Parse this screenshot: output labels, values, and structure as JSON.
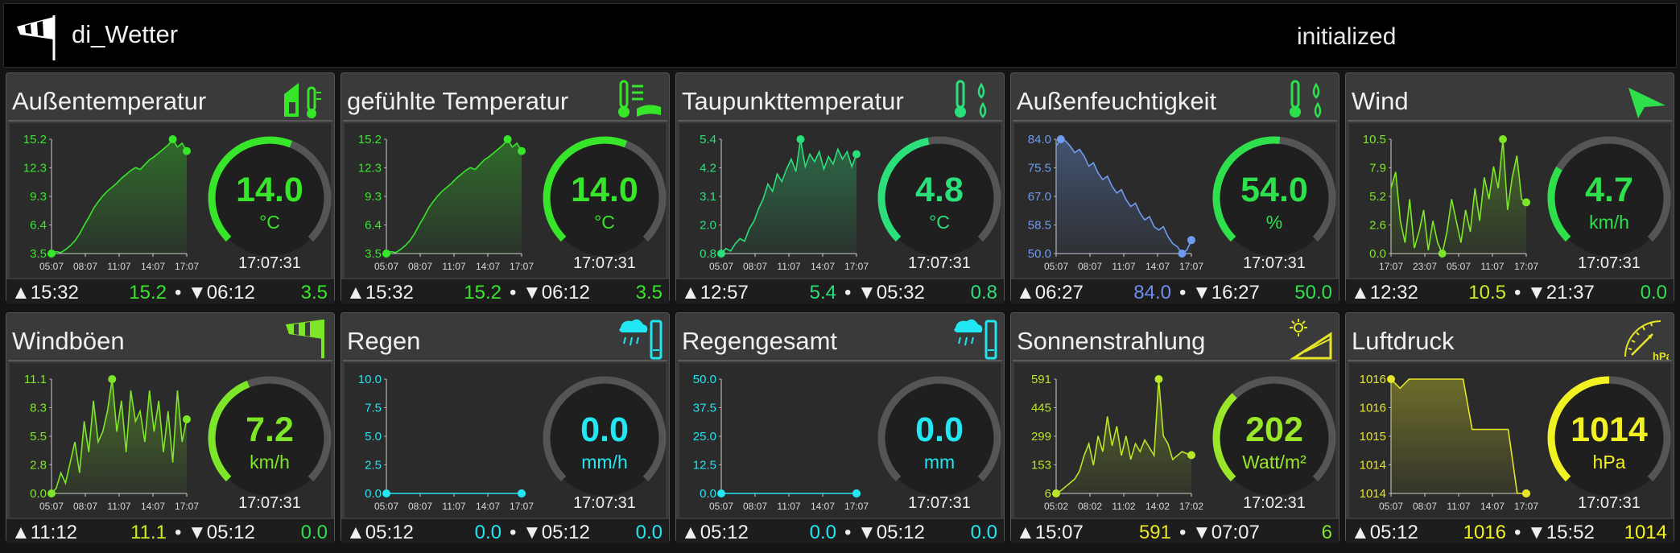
{
  "app": {
    "title": "di_Wetter",
    "status": "initialized"
  },
  "tiles": [
    {
      "title": "Außentemperatur",
      "icon": "thermometer-house-icon",
      "value": "14.0",
      "unit": "°C",
      "time": "17:07:31",
      "color": "#37e629",
      "gauge_fraction": 0.58,
      "chart": {
        "yticks": [
          "15.2",
          "12.3",
          "9.3",
          "6.4",
          "3.5"
        ],
        "xticks": [
          "05:07",
          "08:07",
          "11:07",
          "14:07",
          "17:07"
        ],
        "line_color": "#37e629",
        "ymin": 3.5,
        "ymax": 15.2,
        "values": [
          3.5,
          3.7,
          3.6,
          3.9,
          4.3,
          4.8,
          5.5,
          6.4,
          7.2,
          8.1,
          8.8,
          9.4,
          9.9,
          10.3,
          10.7,
          11.2,
          11.6,
          12.0,
          12.3,
          12.1,
          12.6,
          13.1,
          13.4,
          13.8,
          14.2,
          14.6,
          15.2,
          14.4,
          14.8,
          14.0
        ],
        "max_index": 26,
        "min_index": 0
      },
      "footer": {
        "max_time": "▲15:32",
        "max": "15.2",
        "min_time": "▼06:12",
        "min": "3.5"
      },
      "footer_color": "#37e629"
    },
    {
      "title": "gefühlte Temperatur",
      "icon": "feels-like-thermometer-icon",
      "value": "14.0",
      "unit": "°C",
      "time": "17:07:31",
      "color": "#37e629",
      "gauge_fraction": 0.58,
      "chart": {
        "yticks": [
          "15.2",
          "12.3",
          "9.3",
          "6.4",
          "3.5"
        ],
        "xticks": [
          "05:07",
          "08:07",
          "11:07",
          "14:07",
          "17:07"
        ],
        "line_color": "#37e629",
        "ymin": 3.5,
        "ymax": 15.2,
        "values": [
          3.5,
          3.7,
          3.6,
          3.9,
          4.3,
          4.8,
          5.5,
          6.4,
          7.2,
          8.1,
          8.8,
          9.4,
          9.9,
          10.3,
          10.7,
          11.2,
          11.6,
          12.0,
          12.3,
          12.1,
          12.6,
          13.1,
          13.4,
          13.8,
          14.2,
          14.6,
          15.2,
          14.4,
          14.8,
          14.0
        ],
        "max_index": 26,
        "min_index": 0
      },
      "footer": {
        "max_time": "▲15:32",
        "max": "15.2",
        "min_time": "▼06:12",
        "min": "3.5"
      },
      "footer_color": "#37e629"
    },
    {
      "title": "Taupunkttemperatur",
      "icon": "dew-point-icon",
      "value": "4.8",
      "unit": "°C",
      "time": "17:07:31",
      "color": "#2be07a",
      "gauge_fraction": 0.46,
      "chart": {
        "yticks": [
          "5.4",
          "4.2",
          "3.1",
          "2.0",
          "0.8"
        ],
        "xticks": [
          "05:07",
          "08:07",
          "11:07",
          "14:07",
          "17:07"
        ],
        "line_color": "#2be07a",
        "ymin": 0.8,
        "ymax": 5.4,
        "values": [
          0.8,
          1.0,
          0.9,
          1.2,
          1.4,
          1.3,
          1.8,
          2.1,
          2.6,
          3.0,
          3.6,
          3.3,
          4.0,
          3.7,
          4.2,
          4.6,
          4.1,
          5.4,
          4.3,
          4.8,
          4.5,
          4.9,
          4.2,
          4.7,
          4.4,
          5.0,
          4.6,
          4.9,
          4.3,
          4.8
        ],
        "max_index": 17,
        "min_index": 0
      },
      "footer": {
        "max_time": "▲12:57",
        "max": "5.4",
        "min_time": "▼05:32",
        "min": "0.8"
      },
      "footer_color": "#2be07a"
    },
    {
      "title": "Außenfeuchtigkeit",
      "icon": "humidity-icon",
      "value": "54.0",
      "unit": "%",
      "time": "17:07:31",
      "color": "#2de04c",
      "gauge_fraction": 0.52,
      "chart": {
        "yticks": [
          "84.0",
          "75.5",
          "67.0",
          "58.5",
          "50.0"
        ],
        "xticks": [
          "05:07",
          "08:07",
          "11:07",
          "14:07",
          "17:07"
        ],
        "line_color": "#6f9cf0",
        "ymin": 50.0,
        "ymax": 84.0,
        "values": [
          82,
          84,
          83.5,
          82,
          80,
          81,
          79,
          76,
          77,
          74,
          72,
          73,
          70,
          68,
          69,
          66,
          64,
          65,
          62,
          60,
          61,
          58,
          57,
          58,
          55,
          53,
          52,
          50,
          51,
          54
        ],
        "max_index": 1,
        "min_index": 27
      },
      "footer": {
        "max_time": "▲06:27",
        "max": "84.0",
        "min_time": "▼16:27",
        "min": "50.0"
      },
      "footer_color": "#2de04c",
      "footer_max_color": "#6f8ef0"
    },
    {
      "title": "Wind",
      "icon": "wind-direction-arrow-icon",
      "value": "4.7",
      "unit": "km/h",
      "time": "17:07:31",
      "color": "#2de04c",
      "gauge_fraction": 0.28,
      "chart": {
        "yticks": [
          "10.5",
          "7.9",
          "5.2",
          "2.6",
          "0.0"
        ],
        "xticks": [
          "17:07",
          "23:07",
          "05:07",
          "11:07",
          "17:07"
        ],
        "line_color": "#7ee628",
        "ymin": 0.0,
        "ymax": 10.5,
        "values": [
          6,
          7.5,
          3,
          1,
          5,
          0.5,
          2,
          4,
          0.3,
          3,
          1,
          0,
          2,
          5,
          3,
          1,
          4,
          2,
          6,
          3,
          7,
          5,
          8,
          6,
          10.5,
          4,
          7,
          9,
          5,
          4.7
        ],
        "max_index": 24,
        "min_index": 11
      },
      "footer": {
        "max_time": "▲12:32",
        "max": "10.5",
        "min_time": "▼21:37",
        "min": "0.0"
      },
      "footer_color": "#2de04c",
      "footer_max_color": "#c5ee22"
    },
    {
      "title": "Windböen",
      "icon": "windsock-icon",
      "value": "7.2",
      "unit": "km/h",
      "time": "17:07:31",
      "color": "#7ee628",
      "gauge_fraction": 0.42,
      "chart": {
        "yticks": [
          "11.1",
          "8.3",
          "5.5",
          "2.8",
          "0.0"
        ],
        "xticks": [
          "05:07",
          "08:07",
          "11:07",
          "14:07",
          "17:07"
        ],
        "line_color": "#7ee628",
        "ymin": 0.0,
        "ymax": 11.1,
        "values": [
          0,
          0.5,
          2,
          1,
          3,
          5,
          2,
          7,
          4,
          9,
          5,
          6,
          8,
          11.1,
          6,
          9,
          4,
          10,
          7,
          8,
          5,
          10,
          6,
          9,
          4,
          8,
          3,
          10,
          5,
          7.2
        ],
        "max_index": 13,
        "min_index": 0
      },
      "footer": {
        "max_time": "▲11:12",
        "max": "11.1",
        "min_time": "▼05:12",
        "min": "0.0"
      },
      "footer_color": "#2de04c",
      "footer_max_color": "#c5ee22"
    },
    {
      "title": "Regen",
      "icon": "rain-gauge-icon",
      "value": "0.0",
      "unit": "mm/h",
      "time": "17:07:31",
      "color": "#22e6f2",
      "gauge_fraction": 0.0,
      "chart": {
        "yticks": [
          "10.0",
          "7.5",
          "5.0",
          "2.5",
          "0.0"
        ],
        "xticks": [
          "05:07",
          "08:07",
          "11:07",
          "14:07",
          "17:07"
        ],
        "line_color": "#22e6f2",
        "ymin": 0.0,
        "ymax": 10.0,
        "values": [
          0,
          0,
          0,
          0,
          0,
          0,
          0,
          0,
          0,
          0
        ],
        "max_index": 0,
        "min_index": 9
      },
      "footer": {
        "max_time": "▲05:12",
        "max": "0.0",
        "min_time": "▼05:12",
        "min": "0.0"
      },
      "footer_color": "#22e6f2",
      "footer_max_color": "#22e6f2"
    },
    {
      "title": "Regengesamt",
      "icon": "rain-gauge-icon",
      "value": "0.0",
      "unit": "mm",
      "time": "17:07:31",
      "color": "#22e6f2",
      "gauge_fraction": 0.0,
      "chart": {
        "yticks": [
          "50.0",
          "37.5",
          "25.0",
          "12.5",
          "0.0"
        ],
        "xticks": [
          "05:07",
          "08:07",
          "11:07",
          "14:07",
          "17:07"
        ],
        "line_color": "#22e6f2",
        "ymin": 0.0,
        "ymax": 50.0,
        "values": [
          0,
          0,
          0,
          0,
          0,
          0,
          0,
          0,
          0,
          0
        ],
        "max_index": 0,
        "min_index": 9
      },
      "footer": {
        "max_time": "▲05:12",
        "max": "0.0",
        "min_time": "▼05:12",
        "min": "0.0"
      },
      "footer_color": "#22e6f2",
      "footer_max_color": "#22e6f2"
    },
    {
      "title": "Sonnenstrahlung",
      "icon": "solar-panel-icon",
      "value": "202",
      "unit": "Watt/m²",
      "time": "17:02:31",
      "color": "#9ae628",
      "gauge_fraction": 0.34,
      "chart": {
        "yticks": [
          "591",
          "445",
          "299",
          "153",
          "6"
        ],
        "xticks": [
          "05:02",
          "08:02",
          "11:02",
          "14:02",
          "17:02"
        ],
        "line_color": "#b8e628",
        "ymin": 6,
        "ymax": 591,
        "values": [
          6,
          20,
          40,
          60,
          80,
          120,
          200,
          260,
          150,
          300,
          220,
          400,
          250,
          350,
          200,
          300,
          180,
          260,
          220,
          280,
          240,
          200,
          591,
          300,
          260,
          180,
          200,
          220,
          210,
          202
        ],
        "max_index": 22,
        "min_index": 0
      },
      "footer": {
        "max_time": "▲15:07",
        "max": "591",
        "min_time": "▼07:07",
        "min": "6"
      },
      "footer_color": "#7ee628",
      "footer_max_color": "#e6e628"
    },
    {
      "title": "Luftdruck",
      "icon": "barometer-icon",
      "value": "1014",
      "unit": "hPa",
      "time": "17:07:31",
      "color": "#f2f222",
      "gauge_fraction": 0.5,
      "chart": {
        "yticks": [
          "1016",
          "1016",
          "1015",
          "1014",
          "1014"
        ],
        "xticks": [
          "05:07",
          "08:07",
          "11:07",
          "14:07",
          "17:07"
        ],
        "line_color": "#e6e628",
        "ymin": 1013.8,
        "ymax": 1016.3,
        "values": [
          1016.3,
          1016.1,
          1016.3,
          1016.3,
          1016.3,
          1016.3,
          1016.3,
          1016.3,
          1016.3,
          1015.2,
          1015.2,
          1015.2,
          1015.2,
          1015.2,
          1013.8,
          1013.8
        ],
        "max_index": 0,
        "min_index": 15
      },
      "footer": {
        "max_time": "▲05:12",
        "max": "1016",
        "min_time": "▼15:52",
        "min": "1014"
      },
      "footer_color": "#f2f222",
      "footer_max_color": "#f2f222"
    }
  ]
}
